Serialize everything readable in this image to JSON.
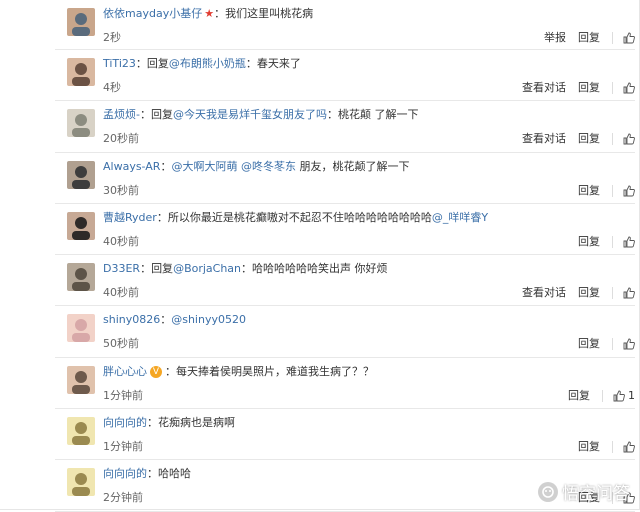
{
  "labels": {
    "report": "举报",
    "reply": "回复",
    "view_conversation": "查看对话",
    "reply_prefix": "回复",
    "colon": "："
  },
  "comments": [
    {
      "user": "依依mayday小基仔",
      "badge": "star",
      "text": "我们这里叫桃花病",
      "time": "2秒",
      "actions": [
        "report",
        "reply",
        "like"
      ]
    },
    {
      "user": "TiTi23",
      "reply_to": "@布朗熊小奶瓶",
      "text": "春天来了",
      "time": "4秒",
      "actions": [
        "view_conversation",
        "reply",
        "like"
      ]
    },
    {
      "user": "孟烦烦-",
      "reply_to": "@今天我是易烊千玺女朋友了吗",
      "text": "桃花颠 了解一下",
      "time": "20秒前",
      "actions": [
        "view_conversation",
        "reply",
        "like"
      ]
    },
    {
      "user": "Always-AR",
      "mentions": "@大啊大阿萌 @咚冬苳东",
      "text": " 朋友，桃花颠了解一下",
      "time": "30秒前",
      "actions": [
        "reply",
        "like"
      ]
    },
    {
      "user": "曹越Ryder",
      "text": "所以你最近是桃花癫嗷对不起忍不住哈哈哈哈哈哈哈哈",
      "mention_after": "@_咩咩睿Y",
      "time": "40秒前",
      "actions": [
        "reply",
        "like"
      ]
    },
    {
      "user": "D33ER",
      "reply_to": "@BorjaChan",
      "text": "哈哈哈哈哈哈笑出声 你好烦",
      "time": "40秒前",
      "actions": [
        "view_conversation",
        "reply",
        "like"
      ]
    },
    {
      "user": "shiny0826",
      "mentions": "@shinyy0520",
      "text": "",
      "time": "50秒前",
      "actions": [
        "reply",
        "like"
      ]
    },
    {
      "user": "胖心心心",
      "badge": "vip",
      "text": "每天捧着侯明昊照片，难道我生病了？？",
      "time": "1分钟前",
      "actions": [
        "reply",
        "like"
      ],
      "like_count": "1"
    },
    {
      "user": "向向向的",
      "text": "花痴病也是病啊",
      "time": "1分钟前",
      "actions": [
        "reply",
        "like"
      ]
    },
    {
      "user": "向向向的",
      "text": "哈哈哈",
      "time": "2分钟前",
      "actions": [
        "reply",
        "like"
      ]
    }
  ],
  "colors": {
    "username": "#3b6fa8",
    "text": "#333333",
    "border": "#e8e8e8"
  },
  "watermark": {
    "text": "悟空问答",
    "icon": "wukong-logo-icon"
  }
}
